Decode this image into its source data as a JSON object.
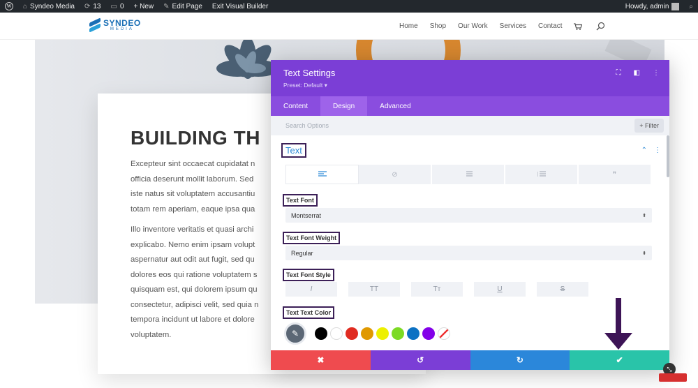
{
  "admin_bar": {
    "site_name": "Syndeo Media",
    "updates": "13",
    "comments": "0",
    "new": "+ New",
    "edit_page": "Edit Page",
    "exit_builder": "Exit Visual Builder",
    "greeting": "Howdy, admin",
    "wp_logo": "W"
  },
  "site_header": {
    "logo_name": "SYNDEO",
    "logo_sub": "MEDIA",
    "nav": [
      "Home",
      "Shop",
      "Our Work",
      "Services",
      "Contact"
    ]
  },
  "hero": {
    "heading": "BUILDING TH",
    "paragraph1": [
      "Excepteur sint occaecat cupidatat n",
      "officia deserunt mollit laborum. Sed",
      "iste natus sit voluptatem accusantiu",
      "totam rem aperiam, eaque ipsa qua"
    ],
    "paragraph2": [
      "Illo inventore veritatis et quasi archi",
      "explicabo. Nemo enim ipsam volupt",
      "aspernatur aut odit aut fugit, sed qu",
      "dolores eos qui ratione voluptatem s",
      "quisquam est, qui dolorem ipsum qu",
      "consectetur, adipisci velit, sed quia n",
      "tempora incidunt ut labore et dolore",
      "voluptatem."
    ]
  },
  "modal": {
    "title": "Text Settings",
    "preset": "Preset: Default ▾",
    "tabs": [
      "Content",
      "Design",
      "Advanced"
    ],
    "active_tab": "Design",
    "search_placeholder": "Search Options",
    "filter_label": "+ Filter",
    "section_title": "Text",
    "fields": {
      "font_label": "Text Font",
      "font_value": "Montserrat",
      "weight_label": "Text Font Weight",
      "weight_value": "Regular",
      "style_label": "Text Font Style",
      "style_buttons": [
        "I",
        "TT",
        "Tт",
        "U",
        "S"
      ],
      "color_label": "Text Text Color"
    },
    "swatches": [
      "#000000",
      "#ffffff",
      "#e02b20",
      "#e09900",
      "#edf000",
      "#7cda24",
      "#0c71c3",
      "#8300e9"
    ],
    "colors": {
      "header": "#7b3ed6",
      "tabs": "#8a4ddf",
      "active_tab": "#9e63ea",
      "cancel": "#ef4b4f",
      "undo": "#7b3ed6",
      "redo": "#2b87da",
      "save": "#29c4a9"
    }
  },
  "annotation": {
    "arrow_color": "#3d1456"
  }
}
